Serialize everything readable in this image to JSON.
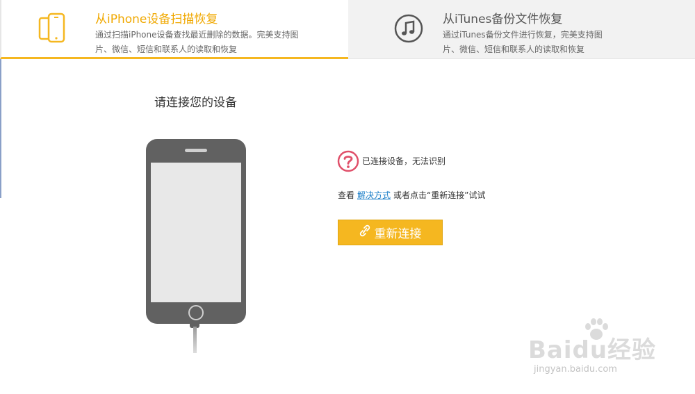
{
  "tabs": {
    "iphone": {
      "title": "从iPhone设备扫描恢复",
      "desc": "通过扫描iPhone设备查找最近删除的数据。完美支持图片、微信、短信和联系人的读取和恢复",
      "icon": "iphone-icon"
    },
    "itunes": {
      "title": "从iTunes备份文件恢复",
      "desc": "通过iTunes备份文件进行恢复，完美支持图片、微信、短信和联系人的读取和恢复",
      "icon": "music-note-icon"
    }
  },
  "main": {
    "connect_title": "请连接您的设备",
    "status_text": "已连接设备，无法识别",
    "hint_prefix": "查看",
    "hint_link": "解决方式",
    "hint_suffix": "或者点击“重新连接”试试",
    "reconnect_label": "重新连接"
  },
  "watermark": {
    "brand": "Baidu经验",
    "sub": "jingyan.baidu.com"
  },
  "colors": {
    "accent": "#f5b720",
    "active_tab_text": "#f0a800",
    "link": "#1a7ec8",
    "phone_body": "#616161",
    "error_icon": "#e0506a"
  }
}
